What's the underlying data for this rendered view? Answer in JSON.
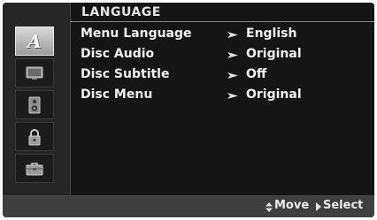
{
  "section": {
    "title": "LANGUAGE"
  },
  "tabs": [
    {
      "name": "language",
      "letter": "A",
      "active": true,
      "icon": "language-icon"
    },
    {
      "name": "display",
      "active": false,
      "icon": "monitor-icon"
    },
    {
      "name": "audio",
      "active": false,
      "icon": "speaker-icon"
    },
    {
      "name": "lock",
      "active": false,
      "icon": "padlock-icon"
    },
    {
      "name": "others",
      "active": false,
      "icon": "toolbox-icon"
    }
  ],
  "menu": [
    {
      "label": "Menu Language",
      "value": "English"
    },
    {
      "label": "Disc Audio",
      "value": "Original"
    },
    {
      "label": "Disc Subtitle",
      "value": "Off"
    },
    {
      "label": "Disc Menu",
      "value": "Original"
    }
  ],
  "footer": {
    "move_label": "Move",
    "select_label": "Select"
  }
}
